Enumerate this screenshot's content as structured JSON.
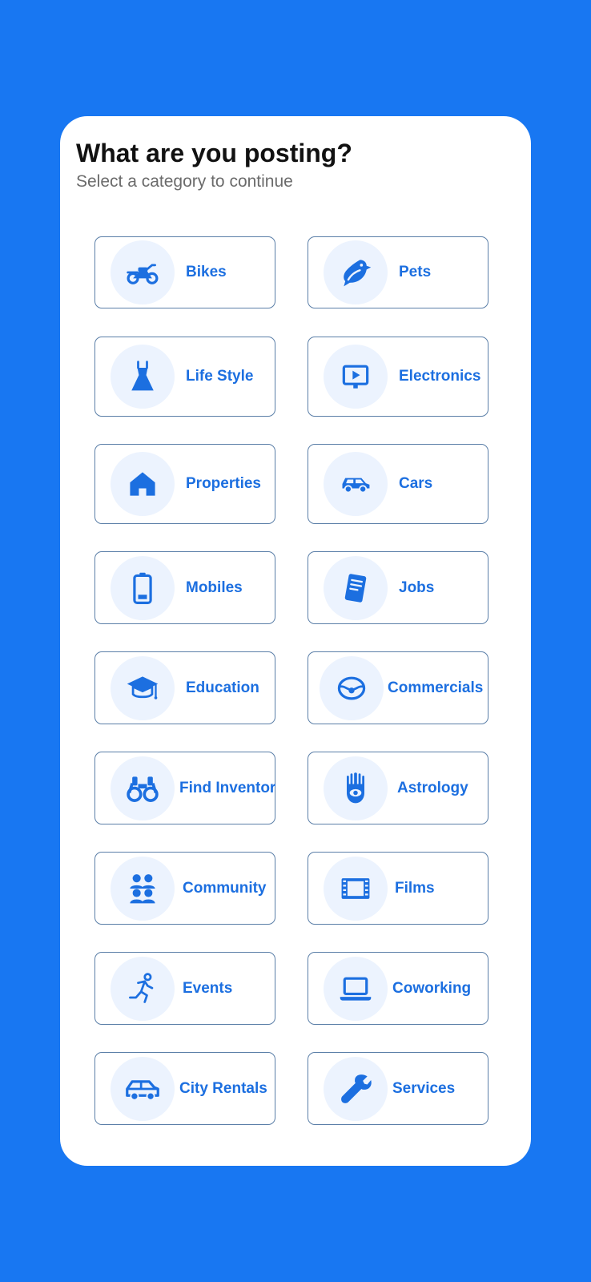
{
  "header": {
    "title": "What are you posting?",
    "subtitle": "Select a category to continue"
  },
  "colors": {
    "background": "#1877F2",
    "accent": "#1C6FE0",
    "icon_circle": "#ECF3FE",
    "tile_border": "#5b7fa8"
  },
  "categories": [
    {
      "label": "Bikes",
      "icon": "motorcycle-icon"
    },
    {
      "label": "Pets",
      "icon": "bird-icon"
    },
    {
      "label": "Life Style",
      "icon": "dress-icon"
    },
    {
      "label": "Electronics",
      "icon": "monitor-play-icon"
    },
    {
      "label": "Properties",
      "icon": "house-icon"
    },
    {
      "label": "Cars",
      "icon": "car-icon"
    },
    {
      "label": "Mobiles",
      "icon": "battery-icon"
    },
    {
      "label": "Jobs",
      "icon": "document-icon"
    },
    {
      "label": "Education",
      "icon": "graduation-cap-icon"
    },
    {
      "label": "Commercials",
      "icon": "steering-wheel-icon"
    },
    {
      "label": "Find Inventor",
      "icon": "binoculars-icon"
    },
    {
      "label": "Astrology",
      "icon": "hamsa-icon"
    },
    {
      "label": "Community",
      "icon": "people-group-icon"
    },
    {
      "label": "Films",
      "icon": "film-icon"
    },
    {
      "label": "Events",
      "icon": "running-person-icon"
    },
    {
      "label": "Coworking",
      "icon": "laptop-icon"
    },
    {
      "label": "City Rentals",
      "icon": "rental-car-icon"
    },
    {
      "label": "Services",
      "icon": "wrench-icon"
    }
  ]
}
